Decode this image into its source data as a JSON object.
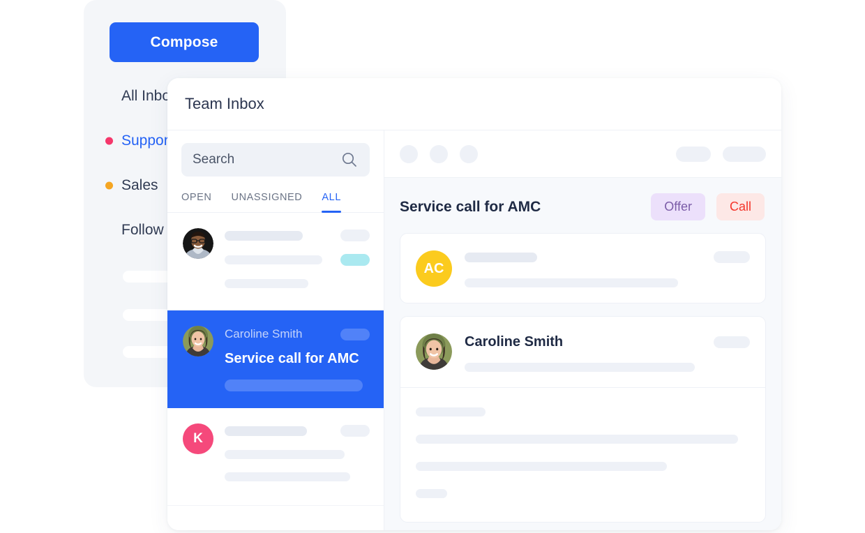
{
  "colors": {
    "accent_blue": "#2563f5",
    "dot_pink": "#f5376b",
    "dot_orange": "#f5a623",
    "badge_offer_bg": "#ece0fb",
    "badge_offer_text": "#7b5ca8",
    "badge_call_bg": "#fde8e6",
    "badge_call_text": "#f5352b",
    "avatar_yellow": "#fbcb1e",
    "avatar_pink": "#f5497b",
    "cyan_pill": "#aae9f0"
  },
  "background_panel": {
    "compose_label": "Compose",
    "nav_items": [
      {
        "label": "All Inbox",
        "dot": null,
        "accent": false
      },
      {
        "label": "Support",
        "dot": "#f5376b",
        "accent": true
      },
      {
        "label": "Sales",
        "dot": "#f5a623",
        "accent": false
      },
      {
        "label": "Follow up",
        "dot": null,
        "accent": false
      }
    ]
  },
  "card": {
    "title": "Team Inbox"
  },
  "search": {
    "placeholder": "Search",
    "value": "",
    "icon": "search-icon"
  },
  "tabs": [
    {
      "label": "OPEN",
      "active": false
    },
    {
      "label": "UNASSIGNED",
      "active": false
    },
    {
      "label": "ALL",
      "active": true
    }
  ],
  "conversations": [
    {
      "avatar_type": "photo-male",
      "name": "",
      "subject": "",
      "selected": false,
      "badge_color": "#aae9f0"
    },
    {
      "avatar_type": "photo-female",
      "name": "Caroline Smith",
      "subject": "Service call for AMC",
      "selected": true,
      "badge_color": null
    },
    {
      "avatar_type": "initial",
      "avatar_initial": "K",
      "avatar_bg": "#f5497b",
      "name": "",
      "subject": "",
      "selected": false,
      "badge_color": null
    }
  ],
  "detail": {
    "toolbar": {
      "circle_count": 3,
      "pill_count": 2
    },
    "title": "Service call for AMC",
    "badges": [
      {
        "label": "Offer",
        "bg": "#ece0fb",
        "color": "#7b5ca8"
      },
      {
        "label": "Call",
        "bg": "#fde8e6",
        "color": "#f5352b"
      }
    ],
    "messages": [
      {
        "avatar_type": "initial",
        "avatar_initial": "AC",
        "avatar_bg": "#fbcb1e",
        "name": "",
        "has_body": false
      },
      {
        "avatar_type": "photo-female",
        "avatar_initial": "",
        "name": "Caroline Smith",
        "has_body": true
      }
    ]
  }
}
